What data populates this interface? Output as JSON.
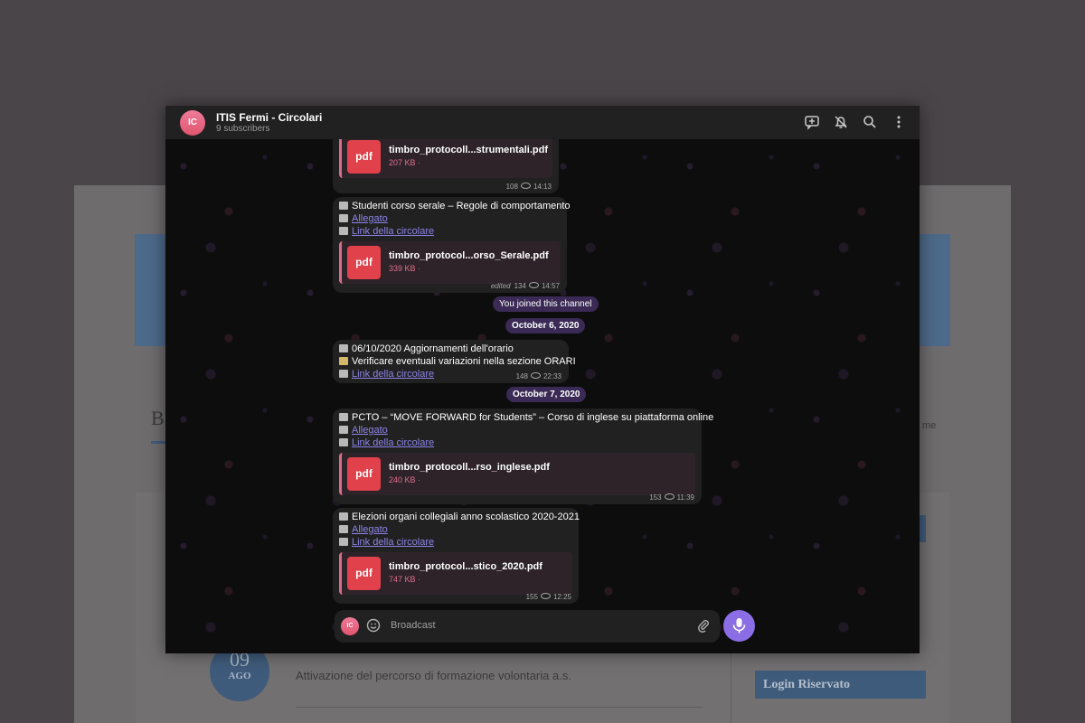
{
  "background_site": {
    "heading_letter": "B",
    "right_fragment": "me",
    "date_day": "09",
    "date_month": "AGO",
    "news_text": "Attivazione del percorso di formazione volontaria a.s.",
    "login_button": "Login Riservato"
  },
  "channel": {
    "avatar_initials": "IC",
    "title": "ITIS Fermi - Circolari",
    "subtitle": "9 subscribers"
  },
  "header_icons": [
    "discussion-icon",
    "mute-bell-icon",
    "search-icon",
    "more-icon"
  ],
  "messages": [
    {
      "file": {
        "icon": "pdf",
        "name": "timbro_protocoll...strumentali.pdf",
        "size": "207 KB ·"
      },
      "views": "108",
      "time": "14:13"
    },
    {
      "title": "Studenti corso serale – Regole di comportamento",
      "attachment_label": "Allegato",
      "link_label": "Link della circolare",
      "file": {
        "icon": "pdf",
        "name": "timbro_protocol...orso_Serale.pdf",
        "size": "339 KB ·"
      },
      "edited": "edited",
      "views": "134",
      "time": "14:57"
    },
    {
      "title": "06/10/2020 Aggiornamenti dell'orario",
      "note": "Verificare eventuali variazioni nella sezione ORARI",
      "link_label": "Link della circolare",
      "views": "148",
      "time": "22:33"
    },
    {
      "title": "PCTO – “MOVE FORWARD for Students” – Corso di inglese su piattaforma online",
      "attachment_label": "Allegato",
      "link_label": "Link della circolare",
      "file": {
        "icon": "pdf",
        "name": "timbro_protocoll...rso_inglese.pdf",
        "size": "240 KB ·"
      },
      "views": "153",
      "time": "11:39"
    },
    {
      "title": "Elezioni organi collegiali anno scolastico 2020-2021",
      "attachment_label": "Allegato",
      "link_label": "Link della circolare",
      "file": {
        "icon": "pdf",
        "name": "timbro_protocol...stico_2020.pdf",
        "size": "747 KB ·"
      },
      "views": "155",
      "time": "12:25"
    }
  ],
  "service": {
    "joined": "You joined this channel",
    "date1": "October 6, 2020",
    "date2": "October 7, 2020"
  },
  "composer": {
    "avatar_initials": "IC",
    "placeholder": "Broadcast"
  },
  "colors": {
    "accent": "#8b6ee6",
    "pdf_red": "#e0414a",
    "link": "#8c84e8",
    "service_pill": "#3a2a55"
  }
}
